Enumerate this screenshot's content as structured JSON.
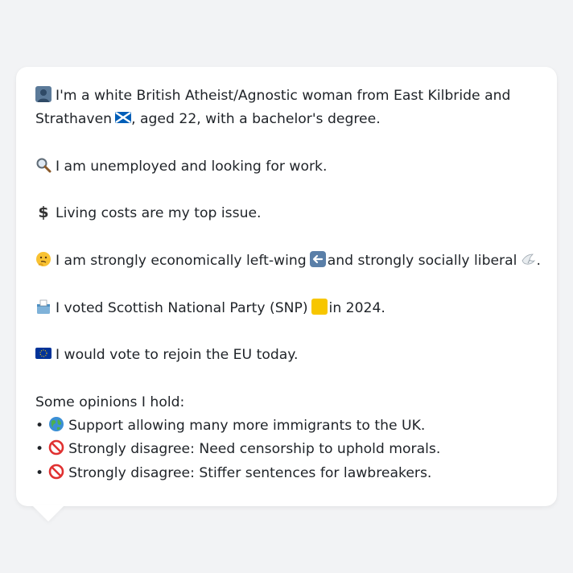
{
  "message": {
    "intro_line1": "I'm a white British Atheist/Agnostic woman from East Kilbride and",
    "intro_line2_a": "Strathaven",
    "intro_line2_b": ", aged 22, with a bachelor's degree.",
    "employment": "I am unemployed and looking for work.",
    "top_issue": "Living costs are my top issue.",
    "politics_a": "I am strongly economically left-wing",
    "politics_b": "and strongly socially liberal",
    "politics_c": ".",
    "vote_a": "I voted Scottish National Party (SNP)",
    "vote_b": "in 2024.",
    "eu": "I would vote to rejoin the EU today.",
    "opinions_heading": "Some opinions I hold:",
    "opinions": [
      "Support allowing many more immigrants to the UK.",
      "Strongly disagree: Need censorship to uphold morals.",
      "Strongly disagree: Stiffer sentences for lawbreakers."
    ]
  },
  "icons": {
    "person": "person-silhouette-icon",
    "scotland_flag": "scotland-flag-icon",
    "magnifier": "magnifying-glass-icon",
    "dollar": "dollar-sign-icon",
    "thinking": "thinking-face-icon",
    "left_arrow": "left-arrow-icon",
    "dove": "dove-icon",
    "ballot": "ballot-box-icon",
    "snp_square": "yellow-square-icon",
    "eu_flag": "eu-flag-icon",
    "globe": "globe-icon",
    "prohibited": "prohibited-icon"
  },
  "colors": {
    "background": "#f2f3f5",
    "card": "#ffffff",
    "text": "#1f2328",
    "snp_yellow": "#f7c600",
    "eu_blue": "#003399",
    "scotland_blue": "#005eb8",
    "prohibited_red": "#e03131"
  }
}
